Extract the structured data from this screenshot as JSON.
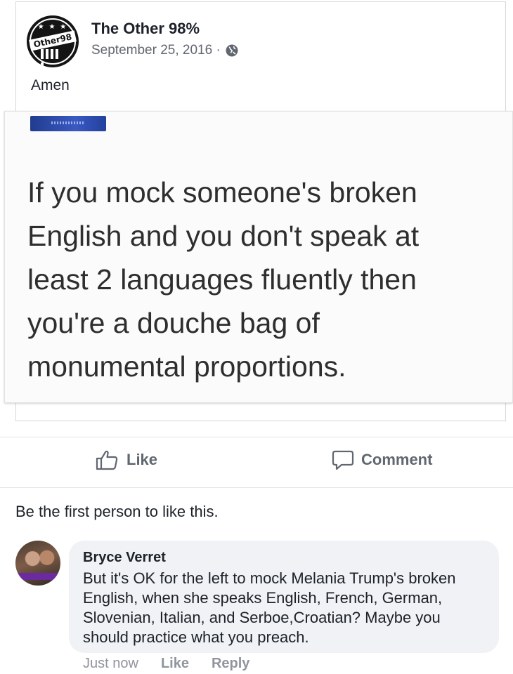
{
  "post": {
    "author": "The Other 98%",
    "avatar_text": "Other98",
    "date": "September 25, 2016 ·",
    "privacy_icon": "globe-icon",
    "text": "Amen",
    "image_text": "If you mock someone's broken\nEnglish and you don't speak at\nleast 2 languages fluently then\nyou're a douche bag of\nmonumental proportions."
  },
  "actions": {
    "like_label": "Like",
    "comment_label": "Comment"
  },
  "likes_summary": "Be the first person to like this.",
  "comment": {
    "author": "Bryce Verret",
    "text": "But it's OK for the left to mock Melania Trump's broken English, when she speaks English, French, German, Slovenian, Italian, and Serboe,Croatian? Maybe you should practice what you preach.",
    "time": "Just now",
    "like_label": "Like",
    "reply_label": "Reply"
  },
  "colors": {
    "secondary_text": "#616770",
    "bubble_bg": "#f0f2f5",
    "divider": "#e5e6e9"
  }
}
